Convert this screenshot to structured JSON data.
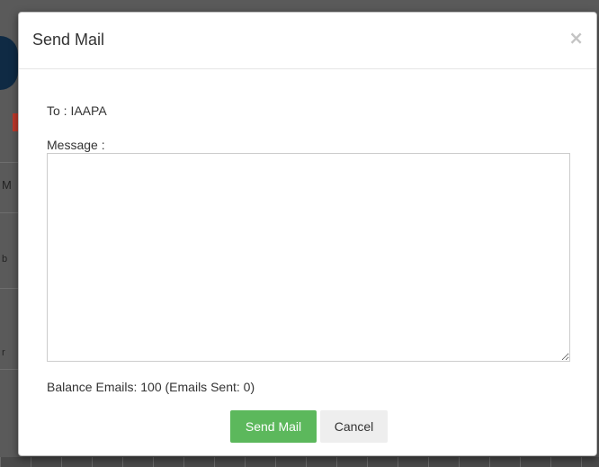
{
  "modal": {
    "title": "Send Mail",
    "close_glyph": "×",
    "to_line": "To : IAAPA",
    "message_label": "Message :",
    "message_value": "",
    "balance_text": "Balance Emails: 100 (Emails Sent: 0)",
    "send_label": "Send Mail",
    "cancel_label": "Cancel"
  },
  "background": {
    "fragments": [
      "M",
      "b",
      "r"
    ]
  },
  "colors": {
    "send_button": "#5cb85c",
    "cancel_button": "#eeeeee",
    "backdrop": "#4a4a4a"
  }
}
